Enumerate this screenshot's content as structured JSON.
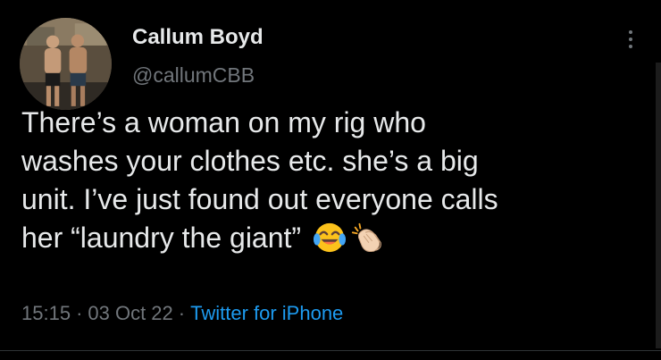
{
  "tweet": {
    "author": {
      "name": "Callum Boyd",
      "handle": "@callumCBB",
      "avatar_icon": "profile-photo-two-men"
    },
    "more_icon": "vertical-ellipsis-icon",
    "text_lines": [
      "There’s a woman on my rig who",
      "washes your clothes etc. she’s a big",
      "unit. I’ve just found out everyone calls",
      "her “laundry the giant”"
    ],
    "emojis": [
      "face-with-tears-of-joy-emoji",
      "clapping-hands-emoji"
    ],
    "time": "15:15",
    "separator": "·",
    "date": "03 Oct 22",
    "source": "Twitter for iPhone"
  },
  "colors": {
    "background": "#000000",
    "primary_text": "#e7e9ea",
    "secondary_text": "#71767b",
    "link": "#1d9bf0"
  }
}
